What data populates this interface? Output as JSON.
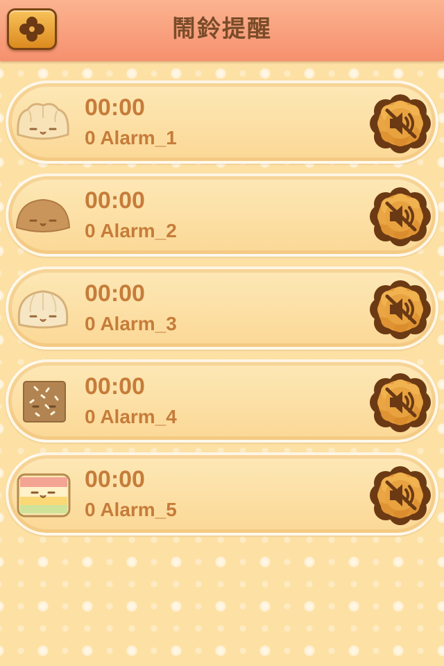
{
  "header": {
    "title": "鬧鈴提醒",
    "close_icon": "close-x-icon"
  },
  "alarms": [
    {
      "time": "00:00",
      "name": "0 Alarm_1",
      "food_icon": "dumpling-face-icon",
      "sound_icon": "mute-icon"
    },
    {
      "time": "00:00",
      "name": "0 Alarm_2",
      "food_icon": "brown-bun-face-icon",
      "sound_icon": "mute-icon"
    },
    {
      "time": "00:00",
      "name": "0 Alarm_3",
      "food_icon": "white-bun-face-icon",
      "sound_icon": "mute-icon"
    },
    {
      "time": "00:00",
      "name": "0 Alarm_4",
      "food_icon": "square-cake-icon",
      "sound_icon": "mute-icon"
    },
    {
      "time": "00:00",
      "name": "0 Alarm_5",
      "food_icon": "layer-cake-icon",
      "sound_icon": "mute-icon"
    }
  ],
  "colors": {
    "background": "#fde1a4",
    "header": "#f6906e",
    "text": "#c67c3a",
    "title": "#7a4c29"
  }
}
